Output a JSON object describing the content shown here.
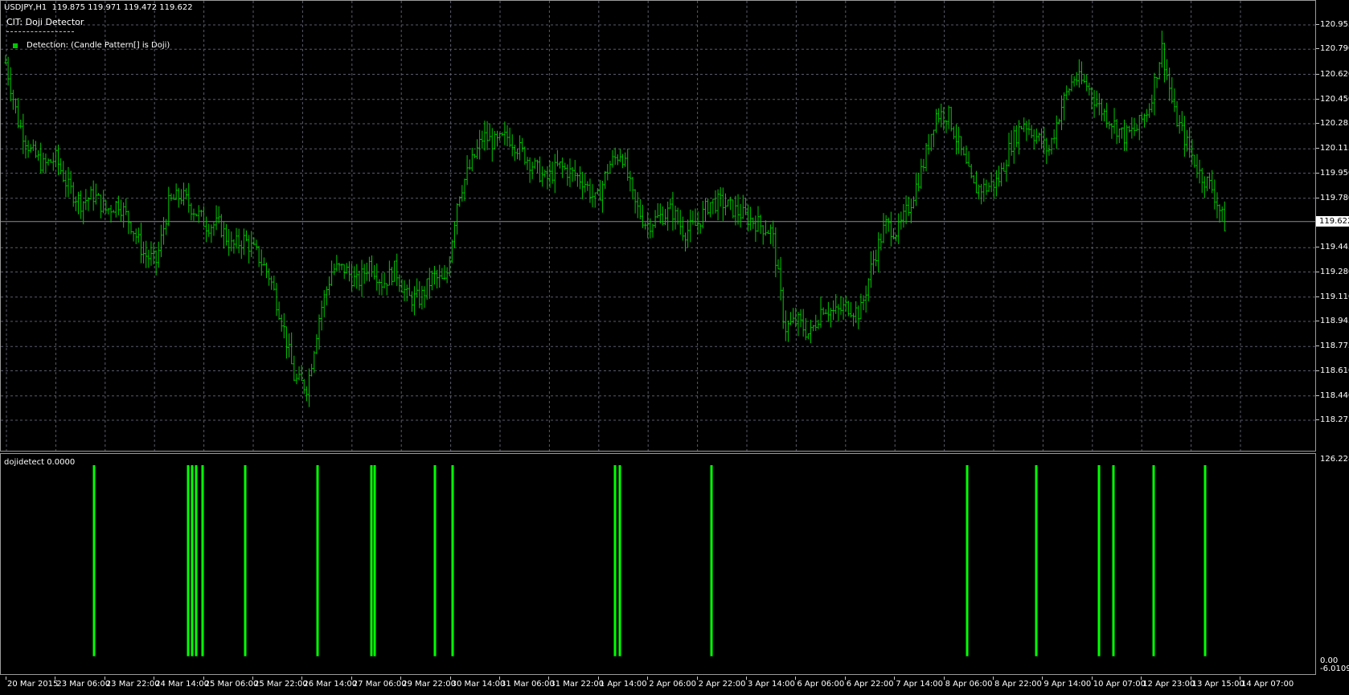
{
  "header": {
    "symbol_info": "USDJPY,H1  119.875 119.971 119.472 119.622",
    "indicator_name": "CIT: Doji Detector",
    "legend_label": "Detection: (Candle Pattern[] is Doji)"
  },
  "colors": {
    "background": "#000000",
    "candle": "#00c800",
    "grid": "#5a5a6a",
    "doji_bar": "#00ff00",
    "bid_line": "#8a8a9a"
  },
  "price_axis": {
    "labels": [
      "120.955",
      "120.790",
      "120.620",
      "120.450",
      "120.285",
      "120.115",
      "119.950",
      "119.780",
      "119.622",
      "119.445",
      "119.280",
      "119.110",
      "118.945",
      "118.775",
      "118.610",
      "118.440",
      "118.275"
    ],
    "current_price": "119.622",
    "range": [
      118.275,
      120.955
    ]
  },
  "sub_window": {
    "title": "dojidetect 0.0000",
    "axis_top": "126.2284",
    "axis_zero": "0.00",
    "axis_bottom": "-6.0109"
  },
  "time_axis": {
    "labels": [
      "20 Mar 2015",
      "23 Mar 06:00",
      "23 Mar 22:00",
      "24 Mar 14:00",
      "25 Mar 06:00",
      "25 Mar 22:00",
      "26 Mar 14:00",
      "27 Mar 06:00",
      "29 Mar 22:00",
      "30 Mar 14:00",
      "31 Mar 06:00",
      "31 Mar 22:00",
      "1 Apr 14:00",
      "2 Apr 06:00",
      "2 Apr 22:00",
      "3 Apr 14:00",
      "6 Apr 06:00",
      "6 Apr 22:00",
      "7 Apr 14:00",
      "8 Apr 06:00",
      "8 Apr 22:00",
      "9 Apr 14:00",
      "10 Apr 07:00",
      "12 Apr 23:00",
      "13 Apr 15:00",
      "14 Apr 07:00"
    ]
  },
  "chart_data": {
    "type": "line",
    "title": "USDJPY,H1",
    "price_range": [
      118.275,
      120.955
    ],
    "close_path": [
      [
        0,
        120.7
      ],
      [
        1,
        120.3
      ],
      [
        2,
        120.1
      ],
      [
        3,
        120.0
      ],
      [
        4,
        120.05
      ],
      [
        5,
        119.85
      ],
      [
        6,
        119.75
      ],
      [
        7,
        119.8
      ],
      [
        8,
        119.7
      ],
      [
        9,
        119.75
      ],
      [
        10,
        119.6
      ],
      [
        11,
        119.4
      ],
      [
        12,
        119.35
      ],
      [
        13,
        119.75
      ],
      [
        14,
        119.8
      ],
      [
        15,
        119.7
      ],
      [
        16,
        119.6
      ],
      [
        17,
        119.6
      ],
      [
        18,
        119.45
      ],
      [
        19,
        119.5
      ],
      [
        20,
        119.4
      ],
      [
        21,
        119.25
      ],
      [
        22,
        118.95
      ],
      [
        23,
        118.55
      ],
      [
        24,
        118.5
      ],
      [
        25,
        119.0
      ],
      [
        26,
        119.3
      ],
      [
        27,
        119.3
      ],
      [
        28,
        119.2
      ],
      [
        29,
        119.35
      ],
      [
        30,
        119.2
      ],
      [
        31,
        119.3
      ],
      [
        32,
        119.1
      ],
      [
        33,
        119.1
      ],
      [
        34,
        119.25
      ],
      [
        35,
        119.2
      ],
      [
        36,
        119.8
      ],
      [
        37,
        120.0
      ],
      [
        38,
        120.2
      ],
      [
        39,
        120.15
      ],
      [
        40,
        120.2
      ],
      [
        41,
        120.1
      ],
      [
        42,
        120.0
      ],
      [
        43,
        119.9
      ],
      [
        44,
        120.0
      ],
      [
        45,
        119.95
      ],
      [
        46,
        119.9
      ],
      [
        47,
        119.75
      ],
      [
        48,
        120.0
      ],
      [
        49,
        120.1
      ],
      [
        50,
        119.75
      ],
      [
        51,
        119.6
      ],
      [
        52,
        119.65
      ],
      [
        53,
        119.7
      ],
      [
        54,
        119.55
      ],
      [
        55,
        119.6
      ],
      [
        56,
        119.75
      ],
      [
        57,
        119.75
      ],
      [
        58,
        119.7
      ],
      [
        59,
        119.65
      ],
      [
        60,
        119.6
      ],
      [
        61,
        119.55
      ],
      [
        62,
        118.9
      ],
      [
        63,
        118.95
      ],
      [
        64,
        118.85
      ],
      [
        65,
        119.05
      ],
      [
        66,
        119.0
      ],
      [
        67,
        119.05
      ],
      [
        68,
        119.0
      ],
      [
        69,
        119.35
      ],
      [
        70,
        119.6
      ],
      [
        71,
        119.55
      ],
      [
        72,
        119.75
      ],
      [
        73,
        120.0
      ],
      [
        74,
        120.35
      ],
      [
        75,
        120.35
      ],
      [
        76,
        120.1
      ],
      [
        77,
        119.85
      ],
      [
        78,
        119.85
      ],
      [
        79,
        119.9
      ],
      [
        80,
        120.15
      ],
      [
        81,
        120.3
      ],
      [
        82,
        120.2
      ],
      [
        83,
        120.1
      ],
      [
        84,
        120.4
      ],
      [
        85,
        120.6
      ],
      [
        86,
        120.55
      ],
      [
        87,
        120.4
      ],
      [
        88,
        120.3
      ],
      [
        89,
        120.2
      ],
      [
        90,
        120.25
      ],
      [
        91,
        120.4
      ],
      [
        92,
        120.8
      ],
      [
        93,
        120.35
      ],
      [
        94,
        120.15
      ],
      [
        95,
        119.95
      ],
      [
        96,
        119.85
      ],
      [
        97,
        119.6
      ]
    ],
    "series": [
      {
        "name": "dojidetect",
        "doji_bar_positions": [
          116,
          233,
          238,
          243,
          251,
          304,
          394,
          461,
          465,
          540,
          562,
          764,
          770,
          884,
          1202,
          1288,
          1366,
          1384,
          1434,
          1498
        ]
      }
    ],
    "sub_range": [
      -6.0109,
      126.2284
    ]
  }
}
